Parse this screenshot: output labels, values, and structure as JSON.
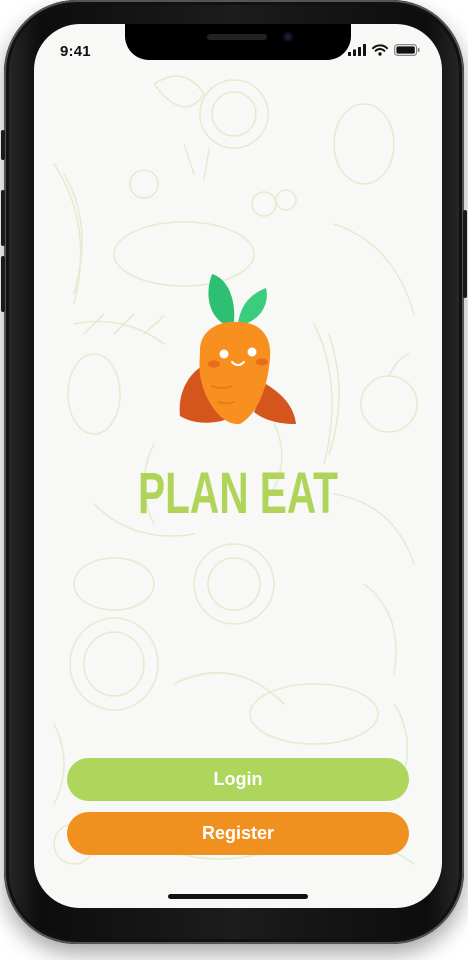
{
  "status_bar": {
    "time": "9:41",
    "icons": [
      "signal-icon",
      "wifi-icon",
      "battery-icon"
    ]
  },
  "brand": {
    "name": "PLAN EAT",
    "logo_icon": "carrot-mascot-icon",
    "color": "#b0d45a"
  },
  "actions": {
    "login_label": "Login",
    "register_label": "Register"
  },
  "colors": {
    "login_button": "#aed65c",
    "register_button": "#f0901f",
    "screen_background": "#f8f9f6"
  }
}
